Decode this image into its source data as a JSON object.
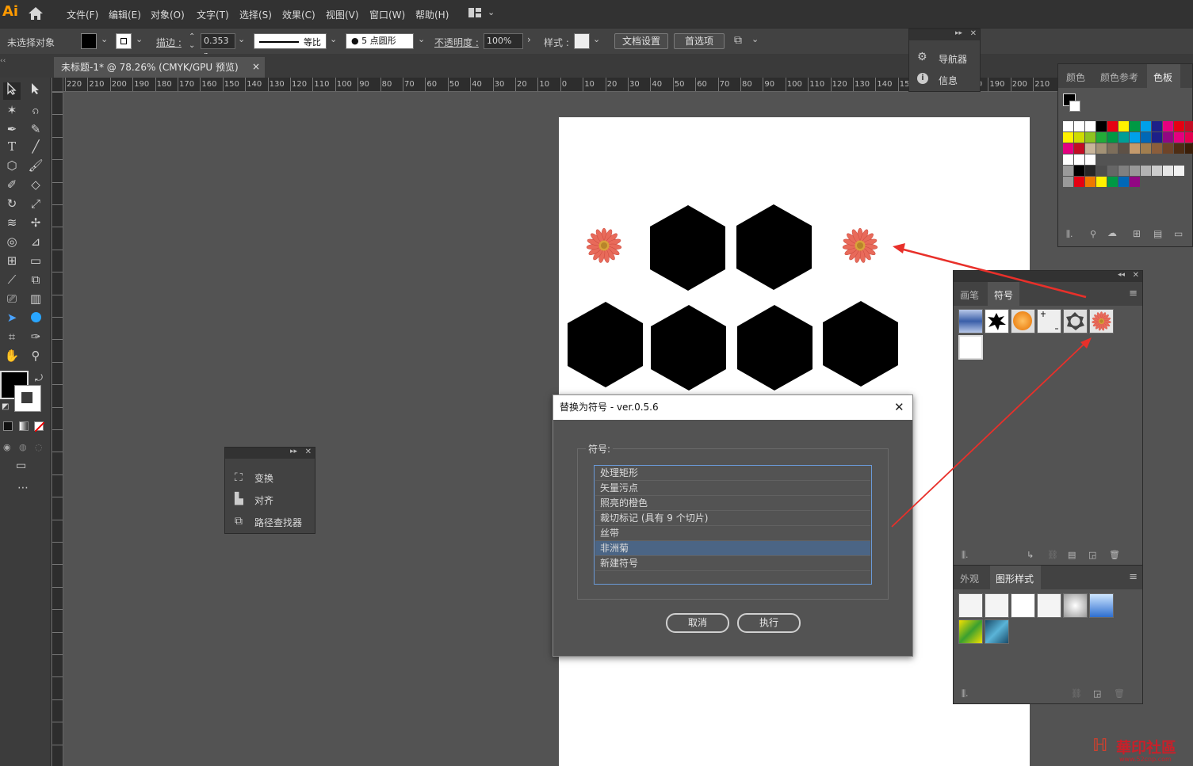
{
  "app": {
    "logo": "Ai"
  },
  "menu": [
    "文件(F)",
    "编辑(E)",
    "对象(O)",
    "文字(T)",
    "选择(S)",
    "效果(C)",
    "视图(V)",
    "窗口(W)",
    "帮助(H)"
  ],
  "control": {
    "selection_status": "未选择对象",
    "stroke_label": "描边 :",
    "stroke_value": "0.353 r",
    "stroke_profile": "等比",
    "brush": "5 点圆形",
    "opacity_label": "不透明度 :",
    "opacity_value": "100%",
    "style_label": "样式 :",
    "doc_setup": "文档设置",
    "preferences": "首选项"
  },
  "document_tab": {
    "title": "未标题-1* @ 78.26% (CMYK/GPU 预览)",
    "close": "×"
  },
  "ruler_h": [
    "220",
    "210",
    "200",
    "190",
    "180",
    "170",
    "160",
    "150",
    "140",
    "130",
    "120",
    "110",
    "100",
    "90",
    "80",
    "70",
    "60",
    "50",
    "40",
    "30",
    "20",
    "10",
    "0",
    "10",
    "20",
    "30",
    "40",
    "50",
    "60",
    "70",
    "80",
    "90",
    "100",
    "110",
    "120",
    "130",
    "140",
    "150",
    "160",
    "170",
    "180",
    "190",
    "200",
    "210"
  ],
  "nav_panel": {
    "items": [
      "导航器",
      "信息"
    ]
  },
  "float_panel": {
    "items": [
      "变换",
      "对齐",
      "路径查找器"
    ]
  },
  "color_panel": {
    "tabs": [
      "颜色",
      "颜色参考",
      "色板"
    ],
    "active": "色板"
  },
  "symbol_panel": {
    "tabs": [
      "画笔",
      "符号"
    ],
    "active": "符号"
  },
  "appearance_panel": {
    "tabs": [
      "外观",
      "图形样式"
    ],
    "active": "图形样式"
  },
  "dialog": {
    "title": "替换为符号 - ver.0.5.6",
    "group_label": "符号:",
    "items": [
      "处理矩形",
      "矢量污点",
      "照亮的橙色",
      "裁切标记 (具有 9 个切片)",
      "丝带",
      "非洲菊",
      "新建符号"
    ],
    "selected_index": 5,
    "cancel": "取消",
    "ok": "执行"
  },
  "watermark": {
    "text": "華印社區",
    "url": "www.52cnp.com"
  },
  "colors": {
    "accent_arrow": "#e8302a",
    "selection_blue": "#4b6585",
    "artboard": "#ffffff"
  }
}
